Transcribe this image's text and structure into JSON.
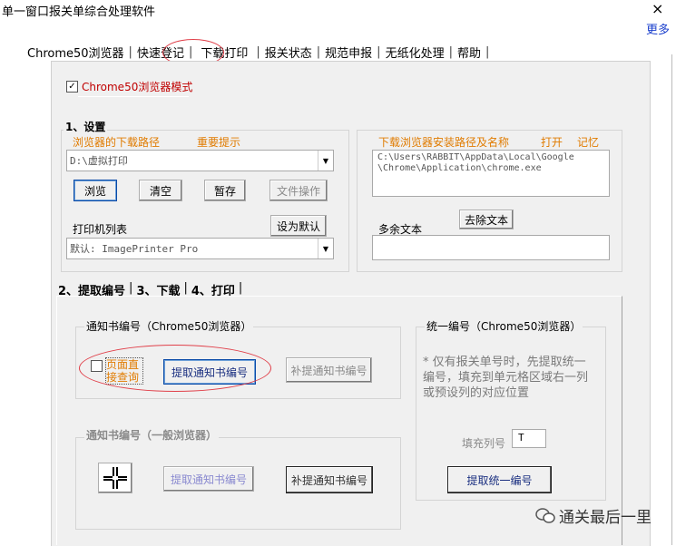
{
  "window": {
    "title": "单一窗口报关单综合处理软件",
    "close_glyph": "×",
    "more_link": "更多"
  },
  "tabs": [
    {
      "label": "Chrome50浏览器"
    },
    {
      "label": "快速登记"
    },
    {
      "label": "下载打印"
    },
    {
      "label": "报关状态"
    },
    {
      "label": "规范申报"
    },
    {
      "label": "无纸化处理"
    },
    {
      "label": "帮助"
    }
  ],
  "tab_separator": "|",
  "chrome_mode": {
    "label": "Chrome50浏览器模式",
    "checked_glyph": "✓"
  },
  "settings": {
    "title": "1、设置",
    "download_path_label": "浏览器的下载路径",
    "important_tip": "重要提示",
    "download_path_value": "D:\\虚拟打印",
    "browse": "浏览",
    "clear": "清空",
    "pause": "暂存",
    "file_ops": "文件操作",
    "printer_list_label": "打印机列表",
    "set_default": "设为默认",
    "printer_value": "默认: ImagePrinter Pro"
  },
  "browser_install": {
    "label": "下载浏览器安装路径及名称",
    "open": "打开",
    "remember": "记忆",
    "path_line1": "C:\\Users\\RABBIT\\AppData\\Local\\Google",
    "path_line2": "\\Chrome\\Application\\chrome.exe",
    "remove_text": "去除文本",
    "extra_text_label": "多余文本"
  },
  "subtabs": [
    {
      "label": "2、提取编号"
    },
    {
      "label": "3、下载"
    },
    {
      "label": "4、打印"
    }
  ],
  "notice_chrome": {
    "title": "通知书编号（Chrome50浏览器）",
    "page_direct_query": "页面直接查询",
    "extract_notice": "提取通知书编号",
    "supplement_notice": "补提通知书编号"
  },
  "notice_general": {
    "title": "通知书编号（一般浏览器）",
    "extract_notice": "提取通知书编号",
    "supplement_notice": "补提通知书编号"
  },
  "unified": {
    "title": "统一编号（Chrome50浏览器）",
    "tip": "* 仅有报关单号时，先提取统一编号，填充到单元格区域右一列或预设列的对应位置",
    "fill_column_label": "填充列号",
    "fill_column_value": "T",
    "extract_unified": "提取统一编号"
  },
  "watermark": {
    "text": "通关最后一里"
  },
  "dropdown_glyph": "▼",
  "colors": {
    "accent_red": "#c00000",
    "orange": "#e07b00",
    "highlight_circle": "#e0404a"
  }
}
